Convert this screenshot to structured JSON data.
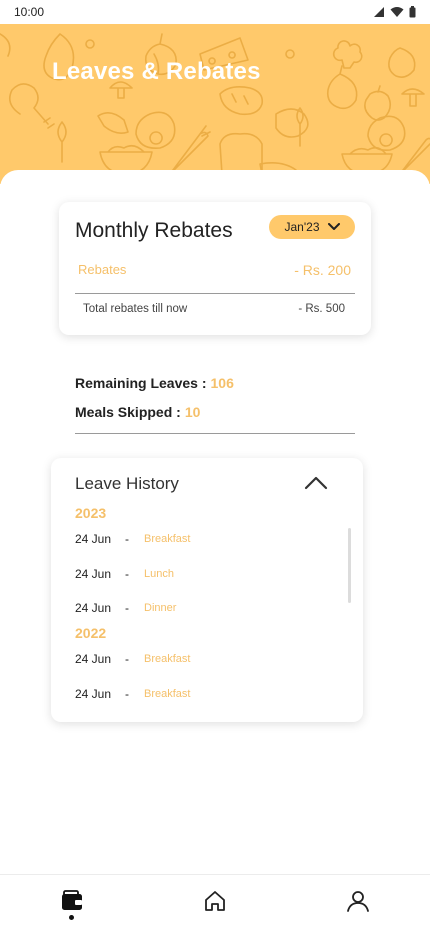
{
  "status_bar": {
    "time": "10:00"
  },
  "header": {
    "title": "Leaves & Rebates"
  },
  "rebates_card": {
    "title": "Monthly Rebates",
    "month_selector": "Jan'23",
    "rebates_label": "Rebates",
    "rebates_value": "- Rs. 200",
    "total_label": "Total rebates till now",
    "total_value": "- Rs. 500"
  },
  "stats": {
    "remaining_leaves_label": "Remaining Leaves :",
    "remaining_leaves_value": "106",
    "meals_skipped_label": "Meals Skipped :",
    "meals_skipped_value": "10"
  },
  "leave_history": {
    "title": "Leave History",
    "groups": [
      {
        "year": "2023",
        "entries": [
          {
            "date": "24 Jun",
            "sep": "-",
            "meal": "Breakfast"
          },
          {
            "date": "24 Jun",
            "sep": "-",
            "meal": "Lunch"
          },
          {
            "date": "24 Jun",
            "sep": "-",
            "meal": "Dinner"
          }
        ]
      },
      {
        "year": "2022",
        "entries": [
          {
            "date": "24 Jun",
            "sep": "-",
            "meal": "Breakfast"
          },
          {
            "date": "24 Jun",
            "sep": "-",
            "meal": "Breakfast"
          }
        ]
      }
    ]
  },
  "bottom_nav": {
    "items": [
      {
        "icon": "wallet-icon",
        "active": true
      },
      {
        "icon": "home-icon",
        "active": false
      },
      {
        "icon": "profile-icon",
        "active": false
      }
    ]
  },
  "colors": {
    "accent": "#ffc96b",
    "accent_text": "#f5c06a",
    "pattern_stroke": "#e8a93f"
  }
}
